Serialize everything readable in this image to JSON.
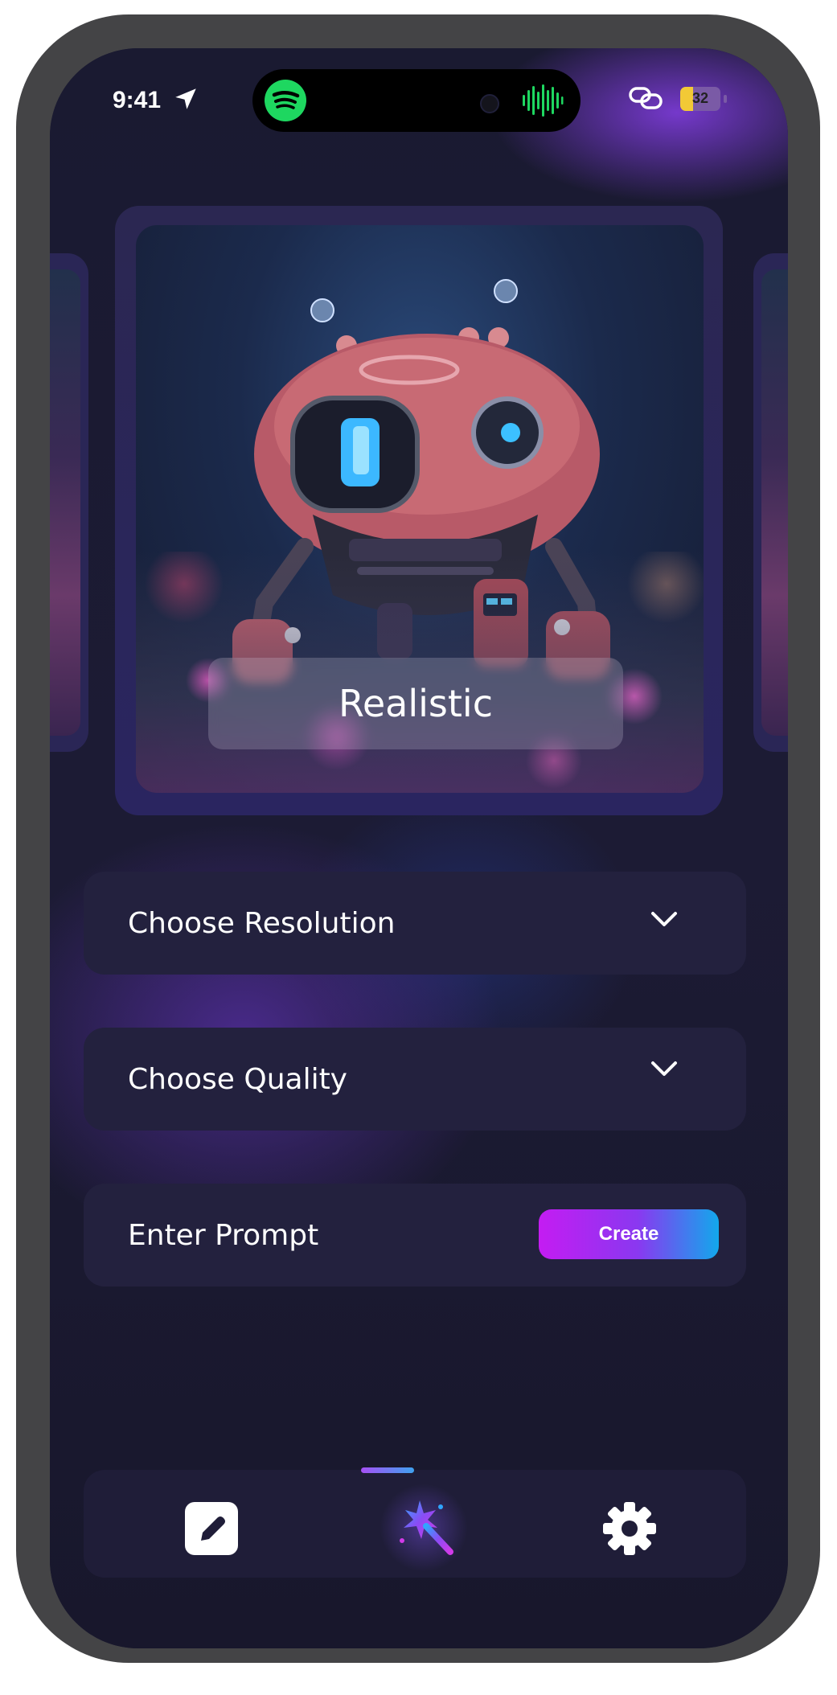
{
  "status_bar": {
    "time": "9:41",
    "battery_percent": "32",
    "battery_level": 0.32,
    "icons": [
      "location-arrow-icon",
      "spotify-icon",
      "audio-wave-icon",
      "link-icon",
      "battery-icon"
    ]
  },
  "carousel": {
    "selected_style": "Realistic"
  },
  "form": {
    "resolution_label": "Choose Resolution",
    "quality_label": "Choose Quality",
    "prompt_label": "Enter Prompt",
    "create_label": "Create"
  },
  "bottom_nav": {
    "items": [
      "edit-icon",
      "magic-wand-icon",
      "gear-icon"
    ],
    "active": "magic-wand-icon"
  },
  "colors": {
    "background": "#1a1930",
    "field_background": "#23213e",
    "accent_start": "#c41cf2",
    "accent_end": "#12a8ec",
    "spotify_green": "#1ed760"
  }
}
